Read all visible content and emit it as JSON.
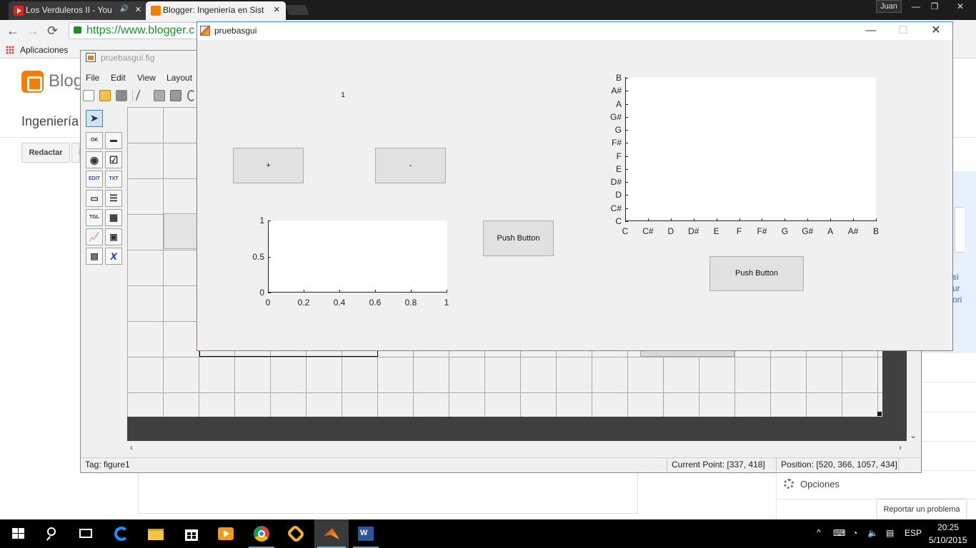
{
  "browser": {
    "tabs": [
      {
        "label": "Los Verduleros II - You",
        "audio": "🔊",
        "close": "✕"
      },
      {
        "label": "Blogger: Ingeniería en Sist",
        "close": "✕"
      }
    ],
    "user": "Juan",
    "url": "https://www.blogger.c",
    "bookmarks": [
      "Aplicaciones"
    ],
    "nav": {
      "back": "←",
      "forward": "→",
      "reload": "⟳"
    },
    "window_controls": {
      "minimize": "—",
      "maximize": "❐",
      "close": "✕"
    }
  },
  "blogger": {
    "wordmark": "Blog",
    "blog_title": "Ingeniería",
    "compose_button": "Redactar",
    "second_button_fragment": "I",
    "right_fragment": [
      "si",
      "ur",
      "ori"
    ],
    "options_label": "Opciones",
    "report_button": "Reportar un problema"
  },
  "guide": {
    "title": "pruebasgui.fig",
    "menu": [
      "File",
      "Edit",
      "View",
      "Layout"
    ],
    "palette": [
      {
        "name": "select-tool",
        "glyph": "➤"
      },
      {
        "name": "pushbutton-tool",
        "glyph": "OK"
      },
      {
        "name": "slider-tool",
        "glyph": "▬"
      },
      {
        "name": "radiobutton-tool",
        "glyph": "◉"
      },
      {
        "name": "checkbox-tool",
        "glyph": "☑"
      },
      {
        "name": "edittext-tool",
        "glyph": "EDIT"
      },
      {
        "name": "statictext-tool",
        "glyph": "TXT"
      },
      {
        "name": "popupmenu-tool",
        "glyph": "▭"
      },
      {
        "name": "listbox-tool",
        "glyph": "☰"
      },
      {
        "name": "togglebutton-tool",
        "glyph": "TGL"
      },
      {
        "name": "table-tool",
        "glyph": "▦"
      },
      {
        "name": "axes-tool",
        "glyph": "📈"
      },
      {
        "name": "panel-tool",
        "glyph": "▣"
      },
      {
        "name": "buttongroup-tool",
        "glyph": "▤"
      },
      {
        "name": "activex-tool",
        "glyph": "X"
      }
    ],
    "status": {
      "tag": "Tag: figure1",
      "current_point": "Current Point:  [337, 418]",
      "position": "Position: [520, 366, 1057, 434]"
    },
    "scroll": {
      "down": "⌄",
      "left": "‹",
      "right": "›"
    }
  },
  "figure": {
    "title": "pruebasgui",
    "window_controls": {
      "minimize": "—",
      "maximize": "☐",
      "close": "✕"
    },
    "counter_text": "1",
    "plus_button": "+",
    "minus_button": "-",
    "push_button_1": "Push Button",
    "push_button_2": "Push Button"
  },
  "chart_data": [
    {
      "type": "line",
      "x_ticks": [
        "0",
        "0.2",
        "0.4",
        "0.6",
        "0.8",
        "1"
      ],
      "y_ticks": [
        "0",
        "0.5",
        "1"
      ],
      "xlim": [
        0,
        1
      ],
      "ylim": [
        0,
        1
      ],
      "series": []
    },
    {
      "type": "scatter",
      "x_ticks": [
        "C",
        "C#",
        "D",
        "D#",
        "E",
        "F",
        "F#",
        "G",
        "G#",
        "A",
        "A#",
        "B"
      ],
      "y_ticks": [
        "C",
        "C#",
        "D",
        "D#",
        "E",
        "F",
        "F#",
        "G",
        "G#",
        "A",
        "A#",
        "B"
      ],
      "series": []
    }
  ],
  "taskbar": {
    "apps": [
      "start",
      "search",
      "task-view",
      "edge",
      "file-explorer",
      "store",
      "media-player",
      "chrome",
      "app-yellow",
      "matlab",
      "word"
    ],
    "language": "ESP",
    "time": "20:25",
    "date": "5/10/2015",
    "tray_chevron": "^"
  },
  "colors": {
    "blogger_orange": "#f57d00",
    "youtube_red": "#e62117",
    "focus_blue": "#3c8dd8",
    "taskbar_underline": "#76b9ed"
  }
}
